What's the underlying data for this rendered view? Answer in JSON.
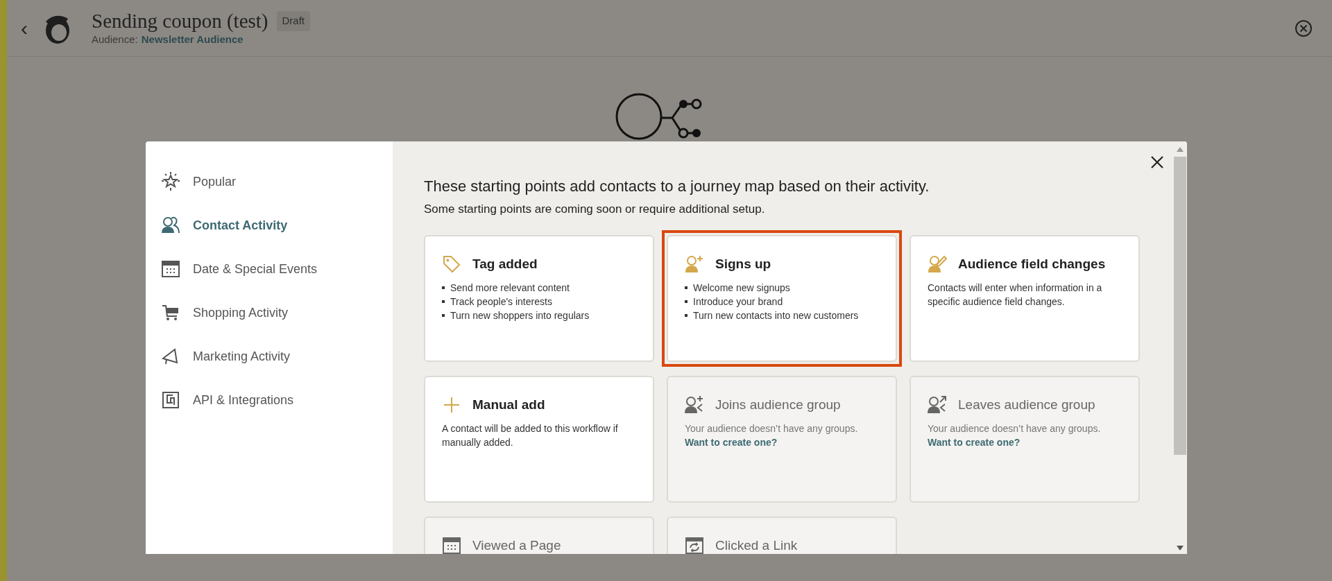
{
  "header": {
    "back": "‹",
    "title": "Sending coupon (test)",
    "badge": "Draft",
    "audience_label": "Audience:",
    "audience": "Newsletter Audience"
  },
  "modal": {
    "heading": "These starting points add contacts to a journey map based on their activity.",
    "subheading": "Some starting points are coming soon or require additional setup.",
    "sidebar": [
      {
        "label": "Popular",
        "kind": "star",
        "selected": false
      },
      {
        "label": "Contact Activity",
        "kind": "people",
        "selected": true
      },
      {
        "label": "Date & Special Events",
        "kind": "calendar",
        "selected": false
      },
      {
        "label": "Shopping Activity",
        "kind": "cart",
        "selected": false
      },
      {
        "label": "Marketing Activity",
        "kind": "megaphone",
        "selected": false
      },
      {
        "label": "API & Integrations",
        "kind": "api",
        "selected": false
      }
    ],
    "cards": [
      {
        "title": "Tag added",
        "kind": "tag",
        "disabled": false,
        "selected": false,
        "bullets": [
          "Send more relevant content",
          "Track people's interests",
          "Turn new shoppers into regulars"
        ]
      },
      {
        "title": "Signs up",
        "kind": "person-plus",
        "disabled": false,
        "selected": true,
        "bullets": [
          "Welcome new signups",
          "Introduce your brand",
          "Turn new contacts into new customers"
        ]
      },
      {
        "title": "Audience field changes",
        "kind": "person-edit",
        "disabled": false,
        "selected": false,
        "text": "Contacts will enter when information in a specific audience field changes."
      },
      {
        "title": "Manual add",
        "kind": "plus",
        "disabled": false,
        "selected": false,
        "text": "A contact will be added to this workflow if manually added."
      },
      {
        "title": "Joins audience group",
        "kind": "group-join",
        "disabled": true,
        "selected": false,
        "text": "Your audience doesn’t have any groups.",
        "link": "Want to create one?"
      },
      {
        "title": "Leaves audience group",
        "kind": "group-leave",
        "disabled": true,
        "selected": false,
        "text": "Your audience doesn’t have any groups.",
        "link": "Want to create one?"
      },
      {
        "title": "Viewed a Page",
        "kind": "calendar",
        "disabled": true,
        "selected": false
      },
      {
        "title": "Clicked a Link",
        "kind": "refresh",
        "disabled": true,
        "selected": false
      }
    ]
  }
}
